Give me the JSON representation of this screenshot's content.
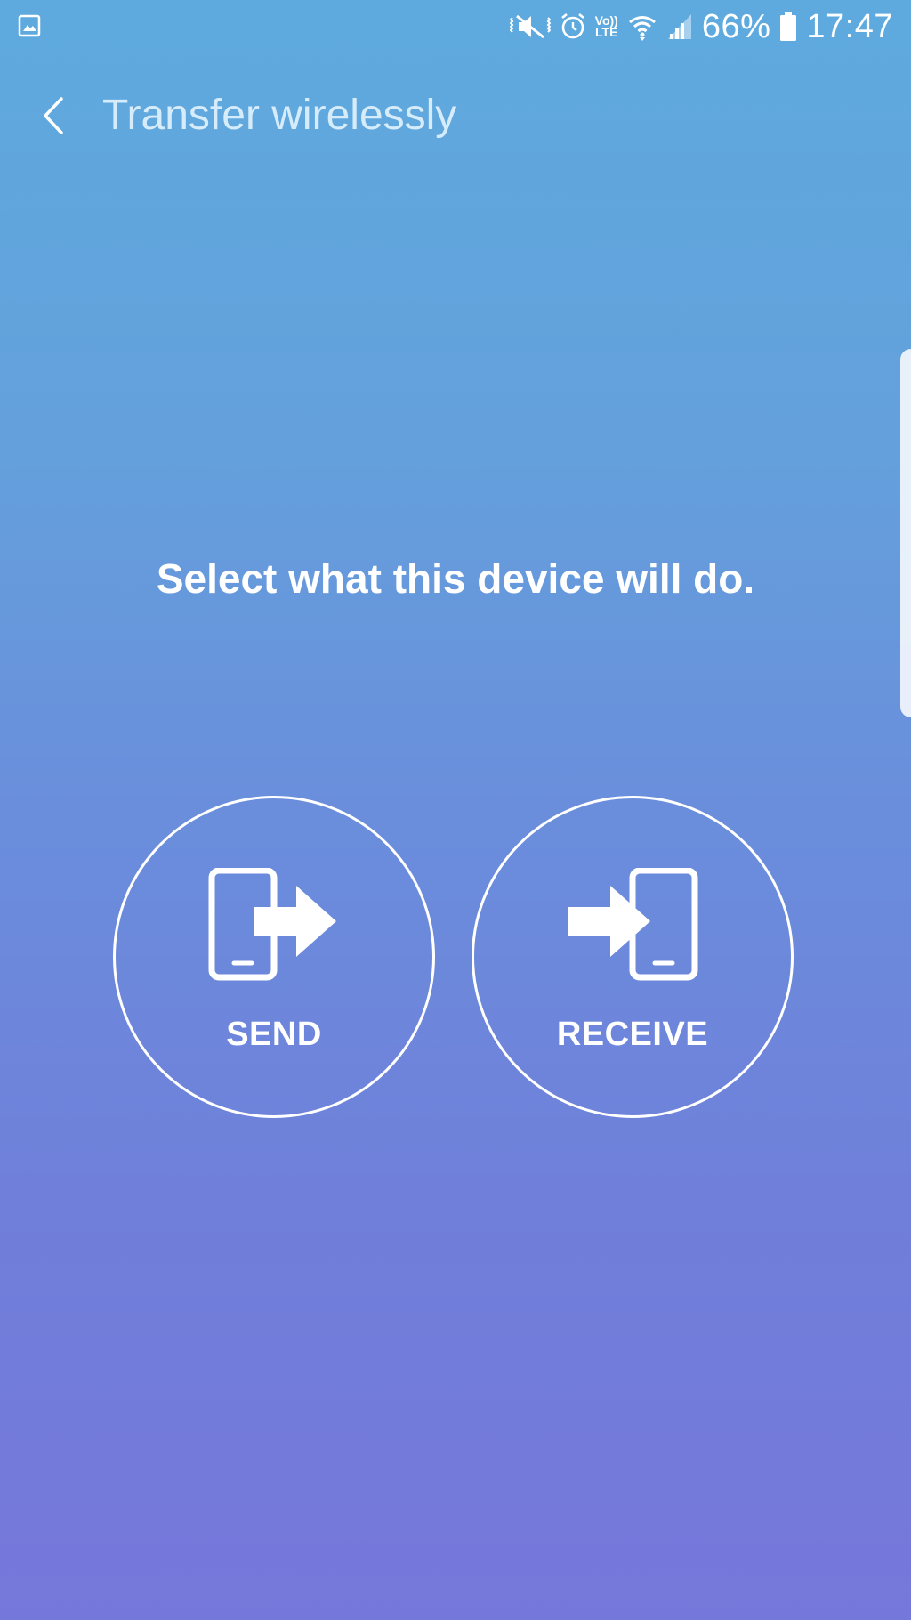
{
  "status_bar": {
    "icons": [
      "gallery-icon",
      "mute-icon",
      "alarm-icon",
      "volte-icon",
      "wifi-icon",
      "signal-icon",
      "battery-icon"
    ],
    "volte_top": "Vo))",
    "volte_bottom": "LTE",
    "battery_percent": "66%",
    "time": "17:47"
  },
  "app_bar": {
    "title": "Transfer wirelessly",
    "back_icon": "chevron-left-icon"
  },
  "main": {
    "prompt": "Select what this device will do.",
    "options": [
      {
        "label": "SEND",
        "icon": "phone-send-icon"
      },
      {
        "label": "RECEIVE",
        "icon": "phone-receive-icon"
      }
    ]
  },
  "colors": {
    "gradient_top": "#5eaade",
    "gradient_bottom": "#7677da",
    "title_text": "#d6ecfa",
    "foreground": "#ffffff"
  }
}
